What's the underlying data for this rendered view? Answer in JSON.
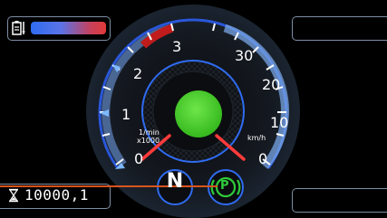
{
  "colors": {
    "background": "#000000",
    "panel_border": "#7d8fa6",
    "ring_blue": "#2a57d8",
    "needle_red": "#ff3b3b",
    "center_green": "#46d12a",
    "park_green": "#2fcc3b",
    "redline": "#c01c1c",
    "gauge_blue": "#7aa6e6",
    "battery_blue": "#2f6bf0",
    "battery_red": "#e23a3a"
  },
  "battery": {
    "icon": "battery-level-icon",
    "level": 0.85
  },
  "tacho": {
    "unit_line1": "1/min",
    "unit_line2": "x1000",
    "ticks": [
      "0",
      "1",
      "2",
      "3"
    ]
  },
  "speedo": {
    "unit": "km/h",
    "ticks": [
      "0",
      "10",
      "20",
      "30"
    ]
  },
  "gear": {
    "label": "N"
  },
  "park_brake": {
    "icon": "parking-brake-icon",
    "label": "P"
  },
  "odometer": {
    "icon": "hourglass-icon",
    "value": "10000,1"
  }
}
